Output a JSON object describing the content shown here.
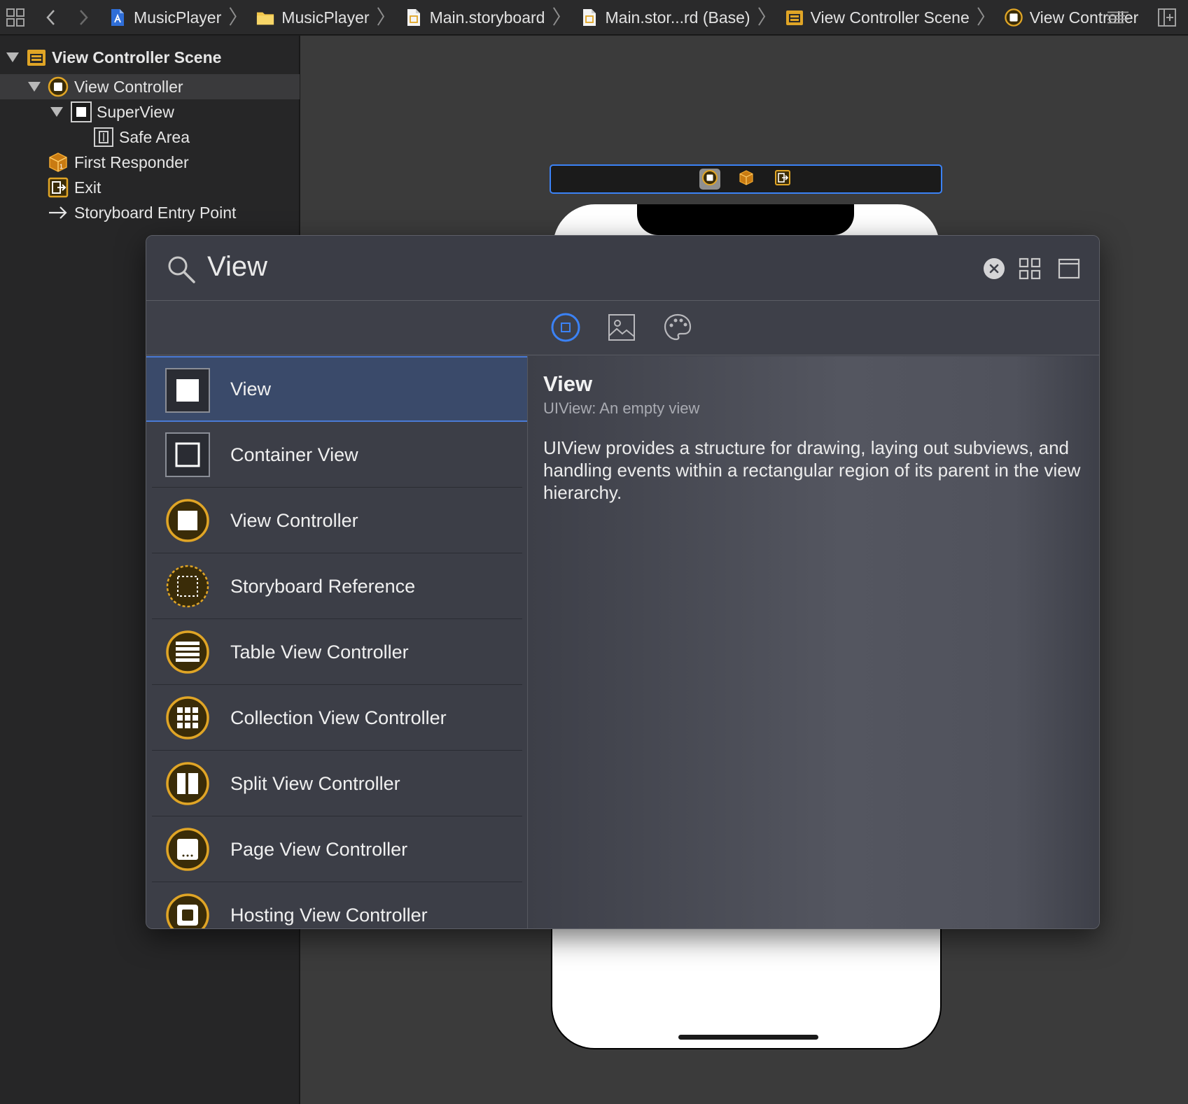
{
  "jumpbar": {
    "crumbs": [
      {
        "label": "MusicPlayer",
        "icon": "project-file-icon"
      },
      {
        "label": "MusicPlayer",
        "icon": "folder-icon"
      },
      {
        "label": "Main.storyboard",
        "icon": "storyboard-file-icon"
      },
      {
        "label": "Main.stor...rd (Base)",
        "icon": "storyboard-file-icon"
      },
      {
        "label": "View Controller Scene",
        "icon": "scene-icon"
      },
      {
        "label": "View Controller",
        "icon": "view-controller-icon"
      }
    ]
  },
  "outline": {
    "rows": [
      {
        "label": "View Controller Scene",
        "icon": "scene-icon"
      },
      {
        "label": "View Controller",
        "icon": "view-controller-icon"
      },
      {
        "label": "SuperView",
        "icon": "view-icon"
      },
      {
        "label": "Safe Area",
        "icon": "safe-area-icon"
      },
      {
        "label": "First Responder",
        "icon": "first-responder-icon"
      },
      {
        "label": "Exit",
        "icon": "exit-icon"
      },
      {
        "label": "Storyboard Entry Point",
        "icon": "arrow-right-icon"
      }
    ]
  },
  "library": {
    "search": {
      "value": "View"
    },
    "tabs": [
      {
        "name": "objects",
        "icon": "object-icon",
        "active": true
      },
      {
        "name": "media",
        "icon": "image-icon",
        "active": false
      },
      {
        "name": "colors",
        "icon": "palette-icon",
        "active": false
      }
    ],
    "items": [
      {
        "label": "View",
        "icon": "view-icon",
        "selected": true
      },
      {
        "label": "Container View",
        "icon": "container-view-icon"
      },
      {
        "label": "View Controller",
        "icon": "view-controller-icon"
      },
      {
        "label": "Storyboard Reference",
        "icon": "storyboard-reference-icon"
      },
      {
        "label": "Table View Controller",
        "icon": "table-view-controller-icon"
      },
      {
        "label": "Collection View Controller",
        "icon": "collection-view-controller-icon"
      },
      {
        "label": "Split View Controller",
        "icon": "split-view-controller-icon"
      },
      {
        "label": "Page View Controller",
        "icon": "page-view-controller-icon"
      },
      {
        "label": "Hosting View Controller",
        "icon": "hosting-view-controller-icon"
      }
    ],
    "detail": {
      "title": "View",
      "subtitle": "UIView: An empty view",
      "description": "UIView provides a structure for drawing, laying out subviews, and handling events within a rectangular region of its parent in the view hierarchy."
    }
  },
  "colors": {
    "accent": "#3b82f6",
    "controller_gold": "#e0a526",
    "selection": "#3a4a6a"
  }
}
